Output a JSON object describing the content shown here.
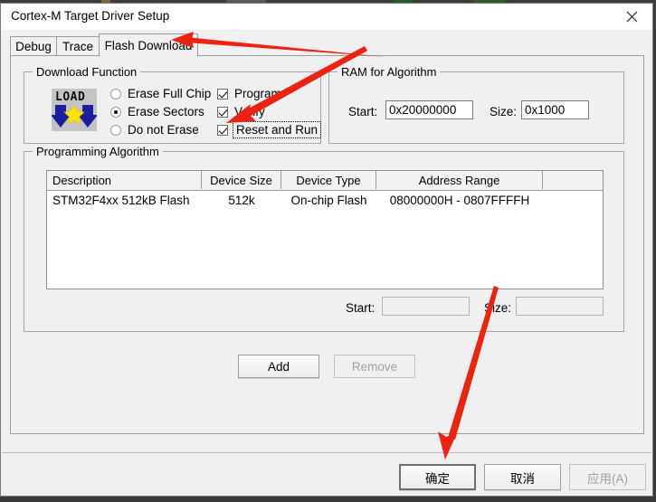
{
  "window": {
    "title": "Cortex-M Target Driver Setup",
    "close_icon": "close-icon"
  },
  "tabs": [
    {
      "label": "Debug",
      "active": false
    },
    {
      "label": "Trace",
      "active": false
    },
    {
      "label": "Flash Download",
      "active": true
    }
  ],
  "download_function": {
    "legend": "Download Function",
    "icon_word": "LOAD",
    "erase_options": [
      {
        "label": "Erase Full Chip",
        "selected": false
      },
      {
        "label": "Erase Sectors",
        "selected": true
      },
      {
        "label": "Do not Erase",
        "selected": false
      }
    ],
    "checkboxes": [
      {
        "label": "Program",
        "checked": true,
        "focused": false
      },
      {
        "label": "Verify",
        "checked": true,
        "focused": false
      },
      {
        "label": "Reset and Run",
        "checked": true,
        "focused": true
      }
    ]
  },
  "ram_for_algorithm": {
    "legend": "RAM for Algorithm",
    "start_label": "Start:",
    "start_value": "0x20000000",
    "size_label": "Size:",
    "size_value": "0x1000"
  },
  "programming_algorithm": {
    "legend": "Programming Algorithm",
    "columns": [
      "Description",
      "Device Size",
      "Device Type",
      "Address Range",
      ""
    ],
    "rows": [
      {
        "description": "STM32F4xx 512kB Flash",
        "device_size": "512k",
        "device_type": "On-chip Flash",
        "address_range": "08000000H - 0807FFFFH"
      }
    ],
    "start_label": "Start:",
    "start_value": "",
    "size_label": "Size:",
    "size_value": "",
    "add_button": "Add",
    "remove_button": "Remove"
  },
  "footer": {
    "ok_button": "确定",
    "cancel_button": "取消",
    "apply_button": "应用(A)"
  },
  "annotations": {
    "color": "#ee2211",
    "arrows": [
      {
        "name": "arrow-to-flash-download-tab"
      },
      {
        "name": "arrow-to-reset-and-run-checkbox"
      },
      {
        "name": "arrow-to-ok-button"
      }
    ]
  }
}
